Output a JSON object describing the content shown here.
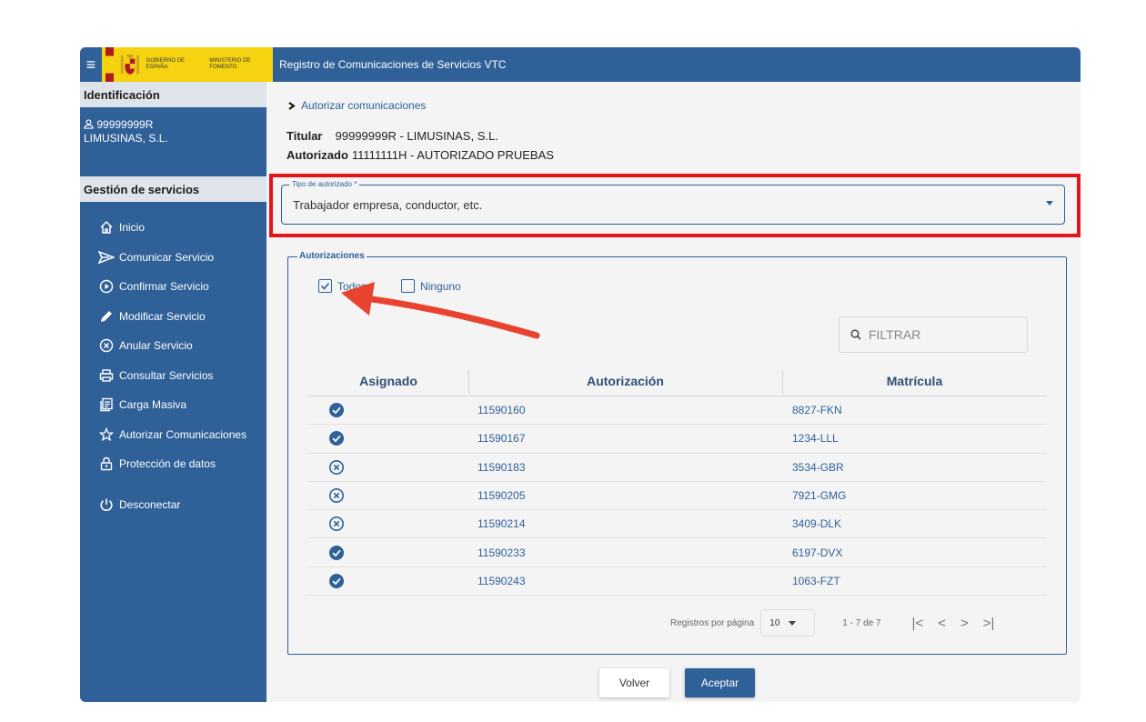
{
  "header": {
    "brand_line1": "Gobierno de España",
    "brand_line2": "Ministerio de Fomento",
    "app_title": "Registro de Comunicaciones de Servicios VTC"
  },
  "sidebar": {
    "identificacion_title": "Identificación",
    "user_id": "99999999R",
    "user_name": "LIMUSINAS, S.L.",
    "gestion_title": "Gestión de servicios",
    "items": [
      {
        "label": "Inicio",
        "icon": "home-icon"
      },
      {
        "label": "Comunicar Servicio",
        "icon": "send-icon"
      },
      {
        "label": "Confirmar Servicio",
        "icon": "play-circle-icon"
      },
      {
        "label": "Modificar Servicio",
        "icon": "pencil-icon"
      },
      {
        "label": "Anular Servicio",
        "icon": "cancel-circle-icon"
      },
      {
        "label": "Consultar Servicios",
        "icon": "printer-icon"
      },
      {
        "label": "Carga Masiva",
        "icon": "copy-list-icon"
      },
      {
        "label": "Autorizar Comunicaciones",
        "icon": "star-icon"
      },
      {
        "label": "Protección de datos",
        "icon": "lock-icon"
      }
    ],
    "logout": {
      "label": "Desconectar",
      "icon": "power-icon"
    }
  },
  "breadcrumb": "Autorizar comunicaciones",
  "info": {
    "titular_label": "Titular",
    "titular_value": "99999999R - LIMUSINAS, S.L.",
    "autorizado_label": "Autorizado",
    "autorizado_value": "11111111H - AUTORIZADO PRUEBAS"
  },
  "tipo": {
    "label": "Tipo de autorizado *",
    "value": "Trabajador empresa, conductor, etc."
  },
  "autorizaciones": {
    "legend": "Autorizaciones",
    "todos_label": "Todos",
    "ninguno_label": "Ninguno",
    "filter_placeholder": "FILTRAR",
    "columns": [
      "Asignado",
      "Autorización",
      "Matrícula"
    ],
    "rows": [
      {
        "assigned": true,
        "autorizacion": "11590160",
        "matricula": "8827-FKN"
      },
      {
        "assigned": true,
        "autorizacion": "11590167",
        "matricula": "1234-LLL"
      },
      {
        "assigned": false,
        "autorizacion": "11590183",
        "matricula": "3534-GBR"
      },
      {
        "assigned": false,
        "autorizacion": "11590205",
        "matricula": "7921-GMG"
      },
      {
        "assigned": false,
        "autorizacion": "11590214",
        "matricula": "3409-DLK"
      },
      {
        "assigned": true,
        "autorizacion": "11590233",
        "matricula": "6197-DVX"
      },
      {
        "assigned": true,
        "autorizacion": "11590243",
        "matricula": "1063-FZT"
      }
    ],
    "pager": {
      "rows_per_page_label": "Registros por página",
      "rows_per_page": "10",
      "range": "1 - 7 de 7"
    }
  },
  "buttons": {
    "volver": "Volver",
    "aceptar": "Aceptar"
  },
  "colors": {
    "primary": "#2f6098",
    "highlight": "#e5141b",
    "brand_yellow": "#f5d310"
  }
}
